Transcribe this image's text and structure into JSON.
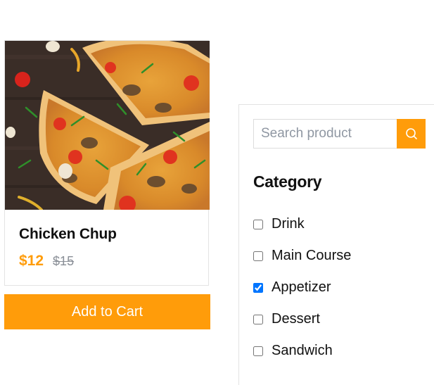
{
  "product": {
    "name": "Chicken Chup",
    "price": "$12",
    "old_price": "$15",
    "image_alt": "pizza-image",
    "add_to_cart_label": "Add to Cart"
  },
  "sidebar": {
    "search": {
      "placeholder": "Search product",
      "value": ""
    },
    "category_title": "Category",
    "categories": [
      {
        "label": "Drink",
        "checked": false
      },
      {
        "label": "Main Course",
        "checked": false
      },
      {
        "label": "Appetizer",
        "checked": true
      },
      {
        "label": "Dessert",
        "checked": false
      },
      {
        "label": "Sandwich",
        "checked": false
      }
    ]
  },
  "colors": {
    "accent": "#ff9c0a",
    "old_price": "#8a8f97",
    "checkbox_checked": "#1a73e8"
  },
  "icons": {
    "search_button": "search-icon"
  }
}
